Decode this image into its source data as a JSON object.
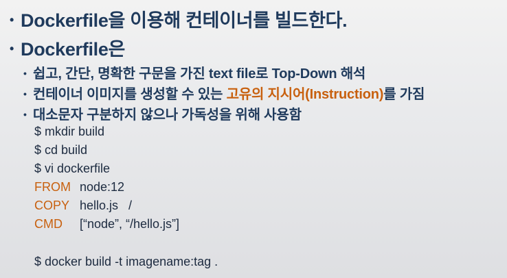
{
  "bullets_level1": [
    {
      "bullet": "•",
      "text": "Dockerfile을 이용해 컨테이너를 빌드한다."
    },
    {
      "bullet": "•",
      "text": "Dockerfile은"
    }
  ],
  "bullets_level2": {
    "item1": {
      "bullet": "•",
      "text": "쉽고, 간단, 명확한 구문을 가진 text file로 Top-Down 해석"
    },
    "item2": {
      "bullet": "•",
      "prefix": "컨테이너 이미지를 생성할 수 있는 ",
      "highlight": "고유의 지시어(Instruction)",
      "suffix": "를 가짐"
    },
    "item3": {
      "bullet": "•",
      "text": "대소문자 구분하지 않으나 가독성을 위해 사용함"
    }
  },
  "commands": {
    "mkdir": "$ mkdir build",
    "cd": "$ cd build",
    "vi": "$ vi dockerfile",
    "from_kw": "FROM",
    "from_val": "node:12",
    "copy_kw": "COPY",
    "copy_val": "hello.js   /",
    "cmd_kw": "CMD",
    "cmd_val": "[“node”, “/hello.js”]",
    "build": "$ docker build -t imagename:tag ."
  },
  "colors": {
    "text": "#1f3a5c",
    "accent": "#c8600e"
  }
}
